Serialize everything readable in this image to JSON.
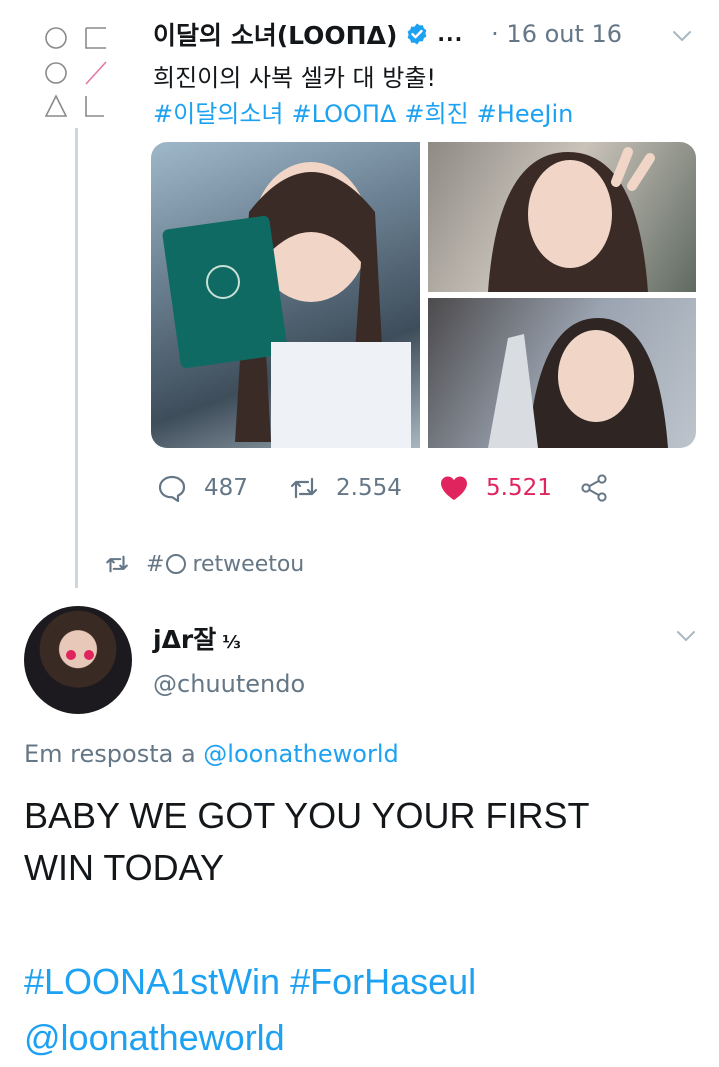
{
  "quoted_tweet": {
    "author_name": "이달의 소녀(LOOПΔ)",
    "ellipsis": "...",
    "date": "· 16 out 16",
    "text": "희진이의 사복 셀카 대 방출!",
    "hashtags": [
      "#이달의소녀",
      "#LOOПΔ",
      "#희진",
      "#HeeJin"
    ],
    "reply_count": "487",
    "retweet_count": "2.554",
    "like_count": "5.521",
    "like_color": "#e0245e"
  },
  "retweet_context": {
    "user_prefix": "#",
    "label": "retweetou"
  },
  "tweet": {
    "author_name": "jΔr잘",
    "author_suffix": "⅓",
    "handle": "@chuutendo",
    "replying_prefix": "Em resposta a",
    "replying_to": "@loonatheworld",
    "body_lines": [
      "BABY WE GOT YOU YOUR FIRST",
      "WIN TODAY"
    ],
    "tags": [
      "#LOONA1stWin",
      "#ForHaseul"
    ],
    "mention": "@loonatheworld"
  },
  "icons": {
    "reply": "reply-icon",
    "retweet": "retweet-icon",
    "like": "heart-icon",
    "share": "share-icon",
    "verified": "verified-badge-icon",
    "caret": "chevron-down-icon"
  },
  "colors": {
    "link": "#1da1f2",
    "secondary_text": "#657786",
    "thread_line": "#ccd6dd"
  }
}
